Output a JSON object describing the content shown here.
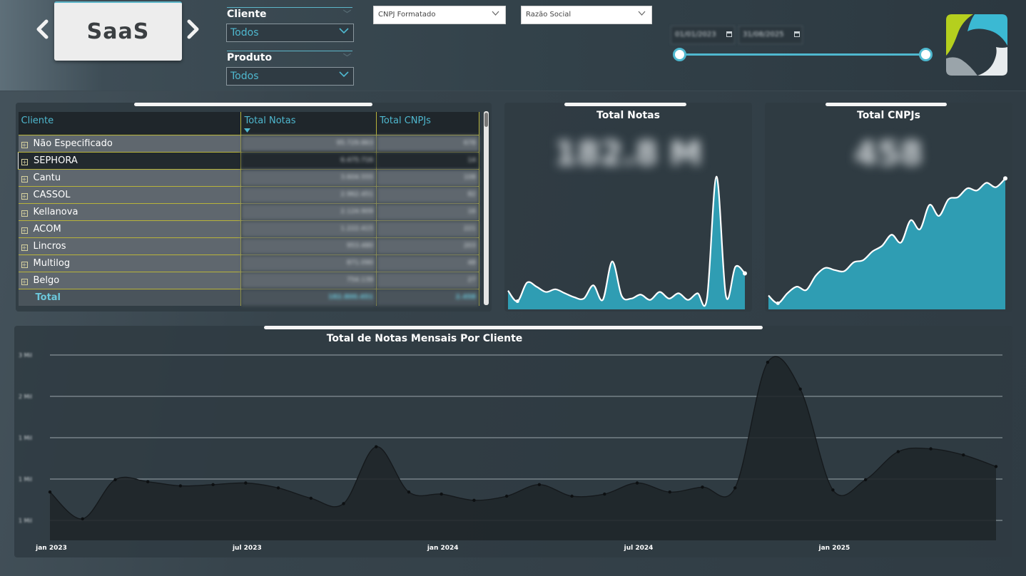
{
  "header": {
    "brand": "SaaS",
    "nav_prev": "‹",
    "nav_next": "›",
    "slicers": [
      {
        "title": "Cliente",
        "value": "Todos"
      },
      {
        "title": "Produto",
        "value": "Todos"
      }
    ],
    "dropdowns": [
      {
        "label": "CNPJ Formatado"
      },
      {
        "label": "Razão Social"
      }
    ],
    "date_range": {
      "start": "01/01/2023",
      "end": "31/08/2025"
    },
    "icons": [
      "chevron-left-icon",
      "chevron-right-icon",
      "chevron-down-icon",
      "calendar-icon",
      "logo-icon"
    ],
    "accent_color": "#4fb8cf"
  },
  "matrix": {
    "columns": [
      "Cliente",
      "Total Notas",
      "Total CNPJs"
    ],
    "rows": [
      {
        "name": "Não Especificado",
        "notas": "95.729.863",
        "cnpjs": "678"
      },
      {
        "name": "SEPHORA",
        "notas": "6.475.716",
        "cnpjs": "14"
      },
      {
        "name": "Cantu",
        "notas": "3.604.555",
        "cnpjs": "108"
      },
      {
        "name": "CASSOL",
        "notas": "2.962.451",
        "cnpjs": "82"
      },
      {
        "name": "Kellanova",
        "notas": "2.124.909",
        "cnpjs": "16"
      },
      {
        "name": "ACOM",
        "notas": "1.222.415",
        "cnpjs": "221"
      },
      {
        "name": "Lincros",
        "notas": "953.480",
        "cnpjs": "203"
      },
      {
        "name": "Multilog",
        "notas": "871.090",
        "cnpjs": "48"
      },
      {
        "name": "Belgo",
        "notas": "754.139",
        "cnpjs": "27"
      }
    ],
    "total": {
      "label": "Total",
      "notas": "182.800.451",
      "cnpjs": "2.458"
    }
  },
  "kpi_notas": {
    "title": "Total Notas",
    "value": "182.8 M",
    "chart_data": {
      "type": "area",
      "values": [
        0.12,
        0.04,
        0.18,
        0.15,
        0.11,
        0.13,
        0.1,
        0.07,
        0.06,
        0.16,
        0.05,
        0.34,
        0.08,
        0.06,
        0.09,
        0.05,
        0.11,
        0.06,
        0.1,
        0.05,
        0.1,
        0.06,
        0.98,
        0.08,
        0.3,
        0.25
      ]
    }
  },
  "kpi_cnpjs": {
    "title": "Total CNPJs",
    "value": "458",
    "chart_data": {
      "type": "area",
      "values": [
        0.1,
        0.03,
        0.12,
        0.18,
        0.15,
        0.28,
        0.35,
        0.33,
        0.32,
        0.4,
        0.42,
        0.5,
        0.55,
        0.65,
        0.58,
        0.78,
        0.7,
        0.92,
        0.82,
        0.97,
        0.99,
        1.07,
        1.05,
        1.12,
        1.08,
        1.16
      ]
    }
  },
  "monthly": {
    "title": "Total de Notas Mensais Por Cliente",
    "chart_data": {
      "type": "area",
      "title": "Total de Notas Mensais Por Cliente",
      "x_labels": [
        "jan 2023",
        "jul 2023",
        "jan 2024",
        "jul 2024",
        "jan 2025"
      ],
      "yticks": [
        "3 Mil",
        "2 Mil",
        "1 Mil",
        "1 Mil",
        "1 Mil"
      ],
      "values": [
        1.0,
        0.35,
        1.3,
        1.25,
        1.15,
        1.18,
        1.22,
        1.1,
        0.85,
        0.72,
        2.1,
        1.0,
        0.95,
        0.8,
        0.9,
        1.18,
        0.9,
        0.95,
        1.22,
        1.0,
        1.12,
        1.1,
        4.15,
        3.5,
        1.05,
        1.3,
        1.98,
        2.05,
        1.9,
        1.62
      ],
      "ymax": 4.5
    }
  }
}
